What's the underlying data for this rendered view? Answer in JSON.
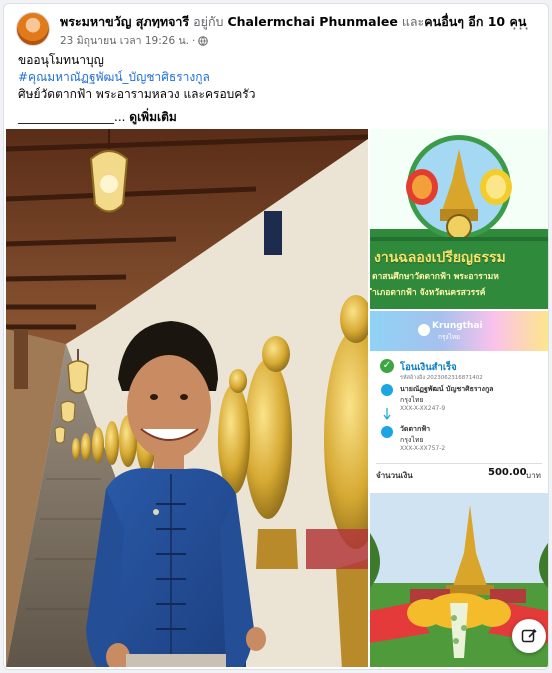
{
  "post": {
    "author": "พระมหาขวัญ สุภทฺทจารี",
    "with_text": "อยู่กับ",
    "tagged": "Chalermchai Phunmalee",
    "and_text": "และ",
    "others": "คนอื่นๆ อีก 10 คน",
    "timestamp": "23 มิถุนายน เวลา 19:26 น.",
    "privacy_separator": "·",
    "more_options": "···"
  },
  "content": {
    "line1": "ขออนุโมทนาบุญ",
    "hashtag": "#คุณมหาณัฏฐพัฒน์_บัญชาศิธรางกูล",
    "line3": "ศิษย์วัดตากฟ้า พระอารามหลวง และครอบครัว",
    "ellipsis": "________________...",
    "see_more": "ดูเพิ่มเติม"
  },
  "banner": {
    "title": "งานฉลองเปรียญธรรม",
    "sub1": "ตาสนศึกษาวัดตากฟ้า พระอารามห",
    "sub2": "ำเภอตากฟ้า จังหวัดนครสวรรค์"
  },
  "receipt": {
    "bank": "Krungthai",
    "bank_sub": "กรุงไทย",
    "status": "โอนเงินสำเร็จ",
    "ref": "รหัสอ้างอิง 2023062316871402",
    "from_name": "นายณัฏฐพัฒน์ บัญชาศิธรางกูล",
    "from_bank": "กรุงไทย",
    "from_acct": "XXX-X-XX247-9",
    "to_name": "วัดตากฟ้า",
    "to_bank": "กรุงไทย",
    "to_acct": "XXX-X-XX757-2",
    "amount_label": "จำนวนเงิน",
    "amount": "500.00",
    "currency": "บาท"
  },
  "colors": {
    "link": "#216fdb",
    "muted": "#65676b",
    "banner_green": "#2f8b3b"
  },
  "icons": {
    "privacy": "globe-icon",
    "edit": "edit-icon"
  }
}
